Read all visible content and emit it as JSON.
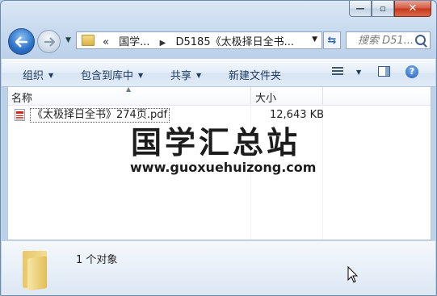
{
  "caption": {
    "minimize": "—",
    "maximize": "▫",
    "close": "✕"
  },
  "nav": {
    "breadcrumb": [
      "«",
      "国学...",
      "D5185《太极择日全书..."
    ],
    "search_placeholder": "搜索 D51..."
  },
  "toolbar": {
    "organize": "组织",
    "include_library": "包含到库中",
    "share": "共享",
    "new_folder": "新建文件夹"
  },
  "columns": {
    "name": "名称",
    "size": "大小"
  },
  "files": [
    {
      "name": "《太极择日全书》274页.pdf",
      "size": "12,643 KB",
      "icon": "pdf-icon"
    }
  ],
  "watermark": {
    "title": "国学汇总站",
    "url": "www.guoxuehuizong.com"
  },
  "details": {
    "count": "1 个对象"
  },
  "colors": {
    "accent": "#2a6fc5",
    "window_frame": "#b9d1ea"
  }
}
